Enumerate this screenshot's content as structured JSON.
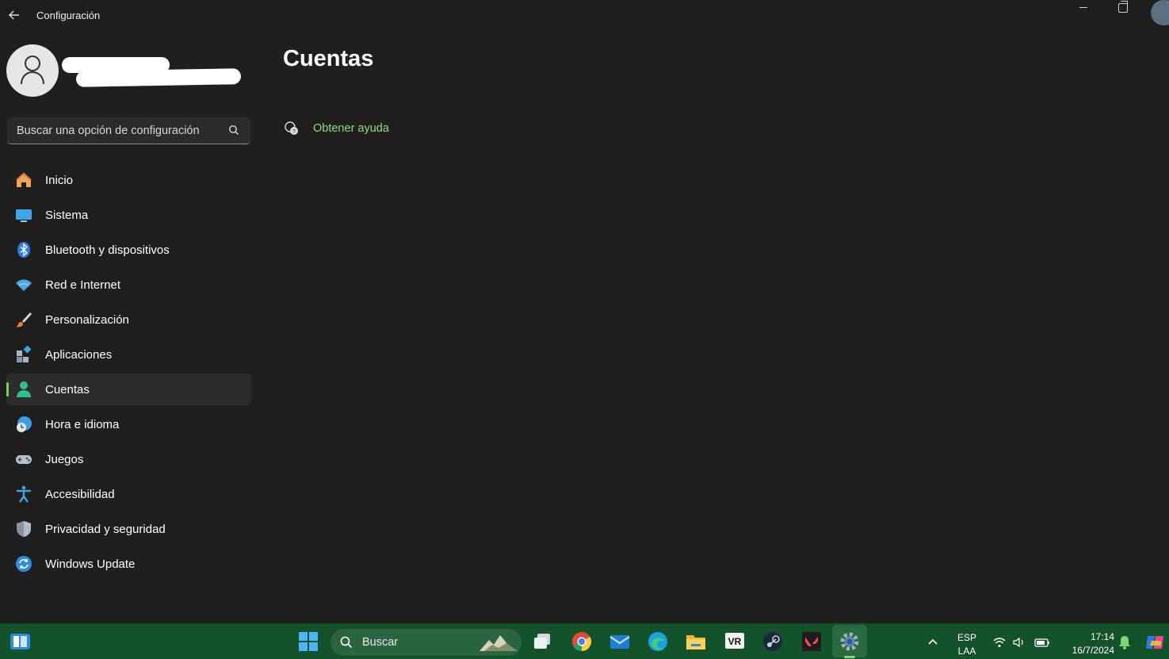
{
  "window": {
    "title": "Configuración",
    "back_icon": "back-arrow-icon",
    "min_icon": "minimize-icon",
    "restore_icon": "restore-icon"
  },
  "search": {
    "placeholder": "Buscar una opción de configuración",
    "icon": "search-icon"
  },
  "nav": {
    "items": [
      {
        "label": "Inicio",
        "icon": "home-icon"
      },
      {
        "label": "Sistema",
        "icon": "system-monitor-icon"
      },
      {
        "label": "Bluetooth y dispositivos",
        "icon": "bluetooth-icon"
      },
      {
        "label": "Red e Internet",
        "icon": "wifi-icon"
      },
      {
        "label": "Personalización",
        "icon": "brush-icon"
      },
      {
        "label": "Aplicaciones",
        "icon": "apps-icon"
      },
      {
        "label": "Cuentas",
        "icon": "account-icon",
        "active": true
      },
      {
        "label": "Hora e idioma",
        "icon": "clock-globe-icon"
      },
      {
        "label": "Juegos",
        "icon": "gamepad-icon"
      },
      {
        "label": "Accesibilidad",
        "icon": "accessibility-icon"
      },
      {
        "label": "Privacidad y seguridad",
        "icon": "shield-icon"
      },
      {
        "label": "Windows Update",
        "icon": "update-icon"
      }
    ]
  },
  "main": {
    "title": "Cuentas",
    "help_link": "Obtener ayuda"
  },
  "taskbar": {
    "search_label": "Buscar",
    "apps": [
      "widgets-icon",
      "start-icon",
      "task-view-icon",
      "chrome-icon",
      "mail-icon",
      "edge-icon",
      "file-explorer-icon",
      "vr-icon",
      "steam-icon",
      "valorant-icon",
      "settings-icon"
    ],
    "language": "ESP",
    "layout": "LAA",
    "time": "17:14",
    "date": "16/7/2024"
  },
  "colors": {
    "background": "#211f1e",
    "accent": "#6fd26f",
    "link": "#8fd98f",
    "taskbar": "#14522b"
  }
}
